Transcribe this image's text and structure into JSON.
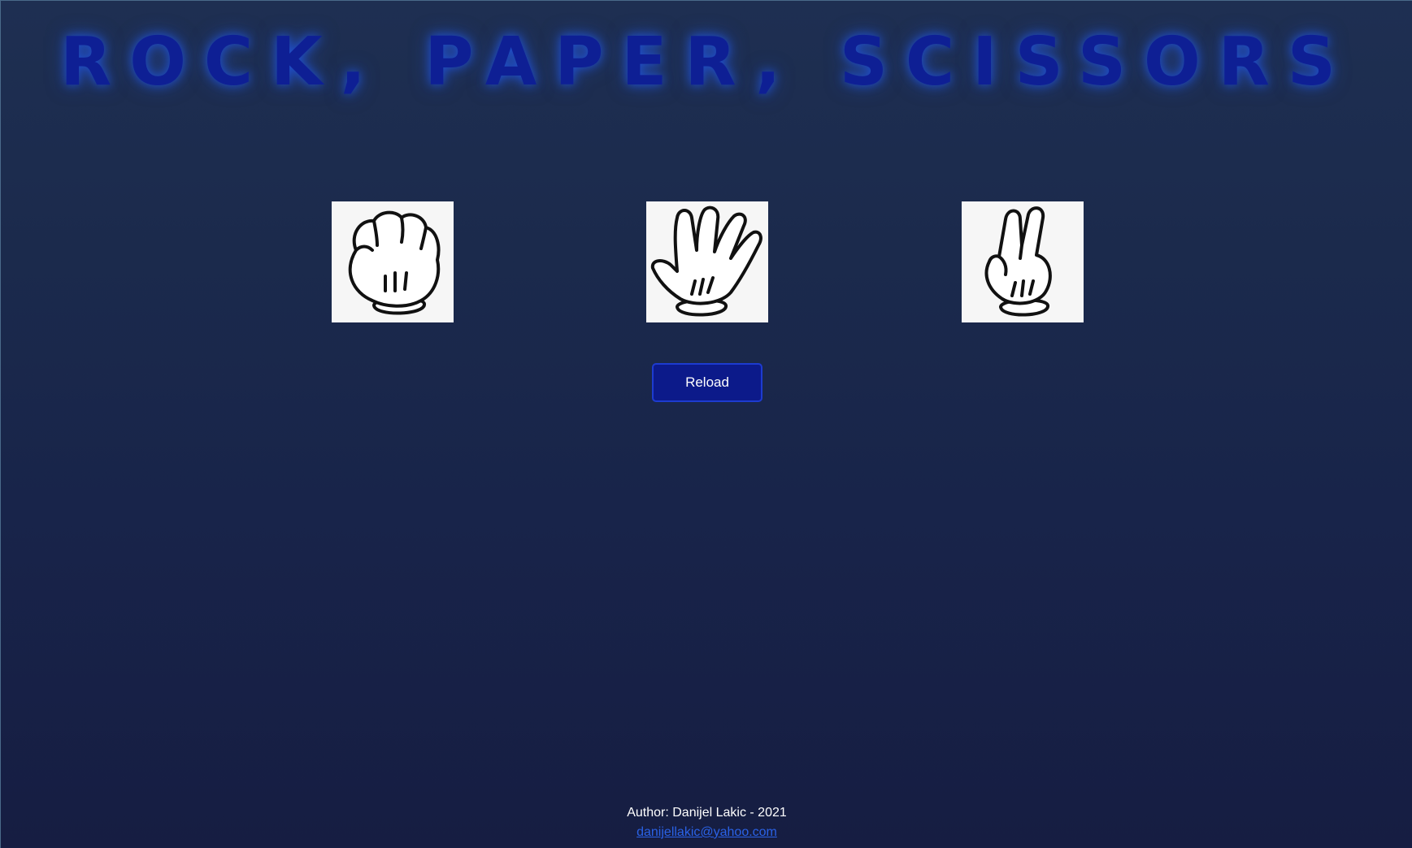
{
  "header": {
    "title": "ROCK, PAPER, SCISSORS"
  },
  "choices": [
    {
      "name": "rock",
      "icon": "rock-hand-icon"
    },
    {
      "name": "paper",
      "icon": "paper-hand-icon"
    },
    {
      "name": "scissors",
      "icon": "scissors-hand-icon"
    }
  ],
  "actions": {
    "reload_label": "Reload"
  },
  "footer": {
    "author": "Author: Danijel Lakic - 2021",
    "email": "danijellakic@yahoo.com"
  },
  "colors": {
    "background": "#1b2a4c",
    "title": "#0e1f94",
    "button": "#0c1a8a",
    "link": "#2a62e6"
  }
}
